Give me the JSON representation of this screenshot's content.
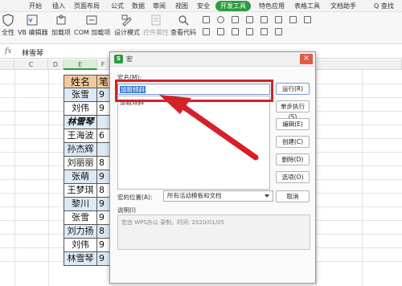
{
  "menubar": {
    "items": [
      "开始",
      "插入",
      "页面布局",
      "公式",
      "数据",
      "审阅",
      "视图",
      "安全",
      "开发工具",
      "特色应用",
      "表格工具",
      "文档助手"
    ],
    "active_index": 8,
    "search_label": "Q 查找"
  },
  "ribbon": {
    "buttons": [
      "全性",
      "VB 编辑器",
      "加载项",
      "COM 加载项",
      "设计模式",
      "控件属性",
      "查看代码"
    ],
    "disabled_index": 5
  },
  "formula_bar": {
    "fx_label": "fx",
    "value": "林雪琴"
  },
  "sheet": {
    "columns": [
      "C",
      "D",
      "E",
      "F"
    ],
    "name_header": "姓名",
    "name_header_partial": "笔",
    "names": [
      "张雪",
      "刘伟",
      "林雪琴",
      "王海波",
      "孙杰辉",
      "刘丽丽",
      "张萌",
      "王梦琪",
      "黎川",
      "张雪",
      "刘力扬",
      "刘伟",
      "林雪琴"
    ],
    "partial_values": [
      "9",
      "9",
      "",
      "6",
      "",
      "8",
      "9",
      "8",
      "9",
      "9",
      "8",
      "9",
      "9"
    ]
  },
  "dialog": {
    "title": "宏",
    "close_label": "×",
    "macro_name_label": "宏名(M):",
    "macro_name_value": "加粗倾斜",
    "macro_list": [
      "加粗倾斜"
    ],
    "buttons": [
      "运行(R)",
      "单步执行(S)",
      "编辑(E)",
      "创建(C)",
      "删除(D)",
      "选项(O)",
      "取消"
    ],
    "location_label": "宏的位置(A):",
    "location_value": "所有活动模板和文档",
    "description_label": "说明(I)",
    "description_text": "宏由 WPS办公 录制，时间: 2020/01/05"
  },
  "colors": {
    "accent": "#2d9b41",
    "highlight_box": "#d5202a",
    "header_fill": "#f4c99a",
    "alt_row": "#ddeaf5"
  }
}
